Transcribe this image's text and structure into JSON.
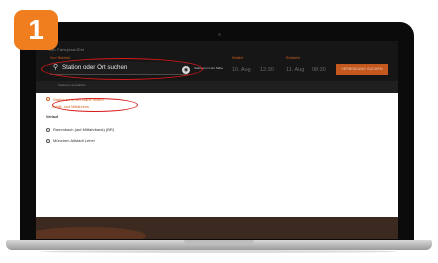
{
  "step": {
    "number": "1"
  },
  "search": {
    "mode_label": "Von  Fahrplan/Ziel",
    "station_label": "Von / Bahnhof",
    "placeholder": "Station oder Ort suchen",
    "nearby_label": "Stationen in der Nähe",
    "search_button": "VERBINDUNG SUCHEN"
  },
  "trip": {
    "departure_label": "Hinfahrt",
    "return_label": "Rückfahrt",
    "depart_date": "10. Aug",
    "depart_time": "12:30",
    "return_date": "11. Aug",
    "return_time": "08:30"
  },
  "toolbar": {
    "text": "Stationen auswählen"
  },
  "results": {
    "nearby_row": "Stationen in der Nähe finden",
    "category_row": "Schiff- und Mitfahrbus",
    "history_heading": "Verlauf",
    "history_items": [
      "Rammbach (auf Mitfahrbank) (BR)",
      "München Altstadt Lehel"
    ]
  },
  "colors": {
    "accent": "#d2611e",
    "highlight": "#d81818",
    "badge": "#f07d1e"
  }
}
